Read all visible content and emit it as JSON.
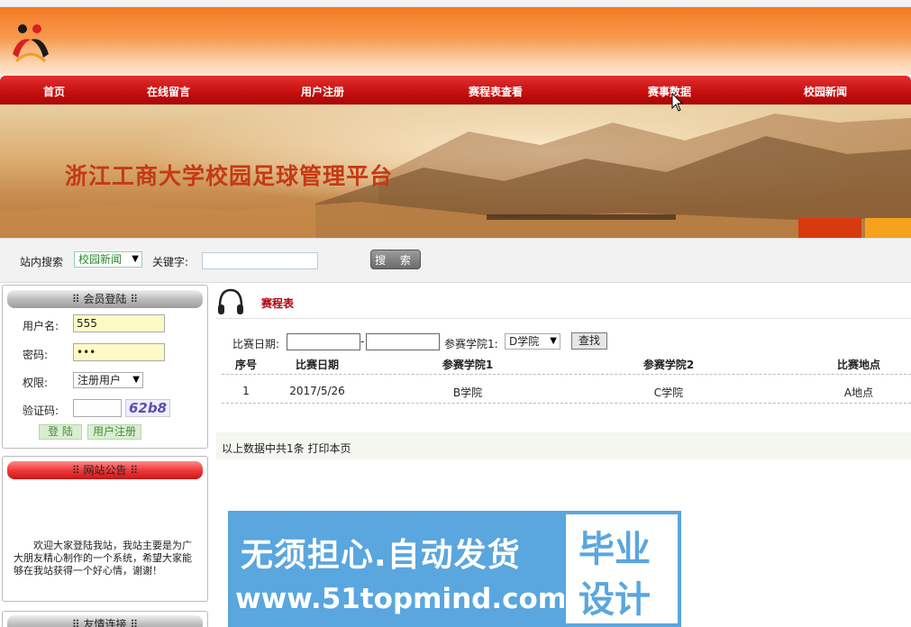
{
  "nav": {
    "items": [
      "首页",
      "在线留言",
      "用户注册",
      "赛程表查看",
      "赛事数据",
      "校园新闻"
    ]
  },
  "banner": {
    "title": "浙江工商大学校园足球管理平台"
  },
  "search": {
    "label": "站内搜索",
    "category_selected": "校园新闻",
    "keyword_label": "关键字:",
    "button": "搜 索"
  },
  "login": {
    "header": "会员登陆",
    "username_label": "用户名:",
    "username_value": "555",
    "password_label": "密码:",
    "password_value": "•••",
    "role_label": "权限:",
    "role_selected": "注册用户",
    "captcha_label": "验证码:",
    "captcha_code": "62b8",
    "login_button": "登 陆",
    "register_button": "用户注册"
  },
  "notice": {
    "header": "网站公告",
    "text": "欢迎大家登陆我站，我站主要是为广大朋友精心制作的一个系统，希望大家能够在我站获得一个好心情，谢谢！"
  },
  "links": {
    "header": "友情连接"
  },
  "main": {
    "title": "赛程表",
    "filter": {
      "date_label": "比赛日期:",
      "dash": "-",
      "college_label": "参赛学院1:",
      "college_selected": "D学院",
      "find_button": "查找"
    },
    "table": {
      "headers": [
        "序号",
        "比赛日期",
        "参赛学院1",
        "参赛学院2",
        "比赛地点"
      ],
      "rows": [
        [
          "1",
          "2017/5/26",
          "B学院",
          "C学院",
          "A地点"
        ]
      ]
    },
    "summary": "以上数据中共1条  打印本页"
  },
  "ad": {
    "line1": "无须担心.自动发货",
    "line2": "www.51topmind.com",
    "box_top": "毕业",
    "box_bottom": "设计"
  }
}
